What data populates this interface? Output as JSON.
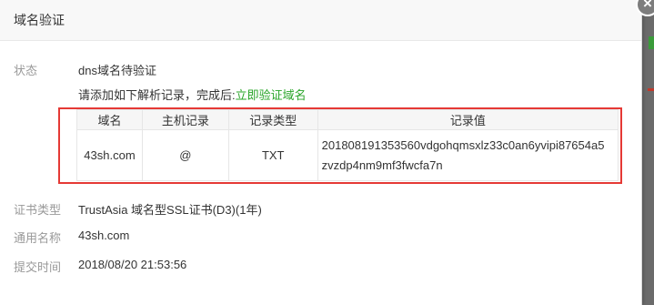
{
  "dialog": {
    "title": "域名验证",
    "close_symbol": "×"
  },
  "status": {
    "label": "状态",
    "value": "dns域名待验证",
    "hint_text": "请添加如下解析记录，完成后:",
    "hint_link": "立即验证域名"
  },
  "records": {
    "headers": [
      "域名",
      "主机记录",
      "记录类型",
      "记录值"
    ],
    "row": {
      "domain": "43sh.com",
      "host": "@",
      "type": "TXT",
      "value_line1": "201808191353560vdgohqmsxlz33c0an6yvipi87654a5",
      "value_line2": "zvzdp4nm9mf3fwcfa7n"
    }
  },
  "details": {
    "cert_type_label": "证书类型",
    "cert_type_value": "TrustAsia 域名型SSL证书(D3)(1年)",
    "common_name_label": "通用名称",
    "common_name_value": "43sh.com",
    "submit_time_label": "提交时间",
    "submit_time_value": "2018/08/20 21:53:56"
  },
  "colors": {
    "link": "#2aa52a",
    "highlight_border": "#e53935"
  }
}
